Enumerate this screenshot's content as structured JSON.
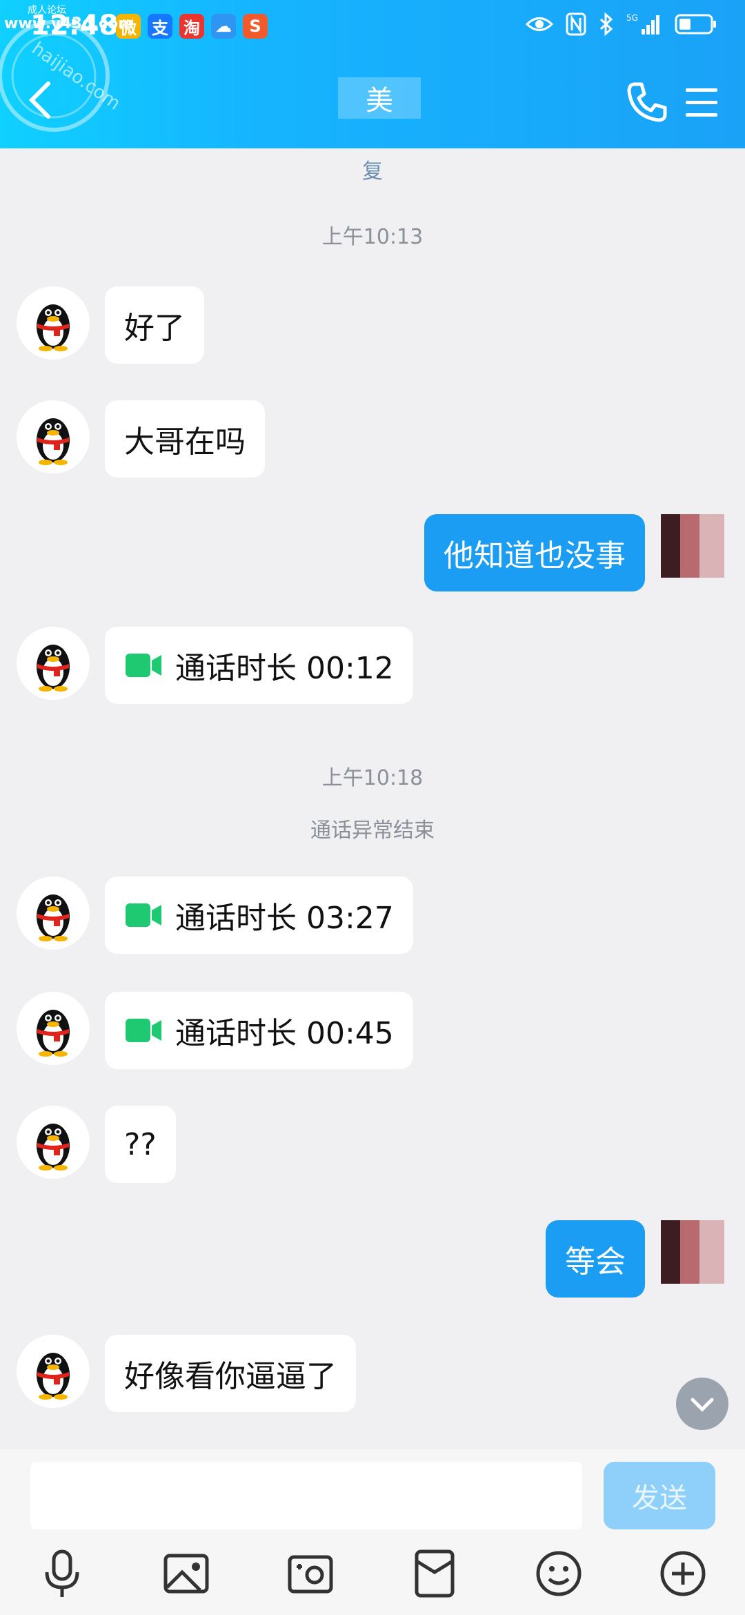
{
  "status_bar": {
    "time": "12:48",
    "apps": [
      {
        "icon": "weibo-app-icon",
        "text": "微",
        "color": "#f5b400"
      },
      {
        "icon": "alipay-app-icon",
        "text": "支",
        "color": "#1677ff"
      },
      {
        "icon": "taobao-app-icon",
        "text": "淘",
        "color": "#e8352f"
      },
      {
        "icon": "weather-app-icon",
        "text": "☁",
        "color": "#2f95f3"
      },
      {
        "icon": "app-icon",
        "text": "S",
        "color": "#f25a2c"
      }
    ]
  },
  "watermark": {
    "site": "www.v43d.com",
    "forum": "成人论坛"
  },
  "header": {
    "contact_name": "美",
    "subtitle": "复"
  },
  "messages": [
    {
      "type": "time",
      "text": "上午10:13"
    },
    {
      "type": "text",
      "side": "left",
      "text": "好了"
    },
    {
      "type": "text",
      "side": "left",
      "text": "大哥在吗"
    },
    {
      "type": "text",
      "side": "right",
      "text": "他知道也没事"
    },
    {
      "type": "call",
      "side": "left",
      "text": "通话时长 00:12"
    },
    {
      "type": "time",
      "text": "上午10:18"
    },
    {
      "type": "system",
      "text": "通话异常结束"
    },
    {
      "type": "call",
      "side": "left",
      "text": "通话时长 03:27"
    },
    {
      "type": "call",
      "side": "left",
      "text": "通话时长 00:45"
    },
    {
      "type": "text",
      "side": "left",
      "text": "??"
    },
    {
      "type": "text",
      "side": "right",
      "text": "等会"
    },
    {
      "type": "text",
      "side": "left",
      "text": "好像看你逼逼了"
    }
  ],
  "composer": {
    "input_value": "",
    "send_label": "发送"
  },
  "toolbar": [
    "voice-icon",
    "image-icon",
    "camera-icon",
    "red-packet-icon",
    "emoji-icon",
    "plus-icon"
  ],
  "colors": {
    "accent": "#1a9df2",
    "call_green": "#1ec972",
    "header_start": "#0fd0ff",
    "header_end": "#1aa2f7"
  }
}
